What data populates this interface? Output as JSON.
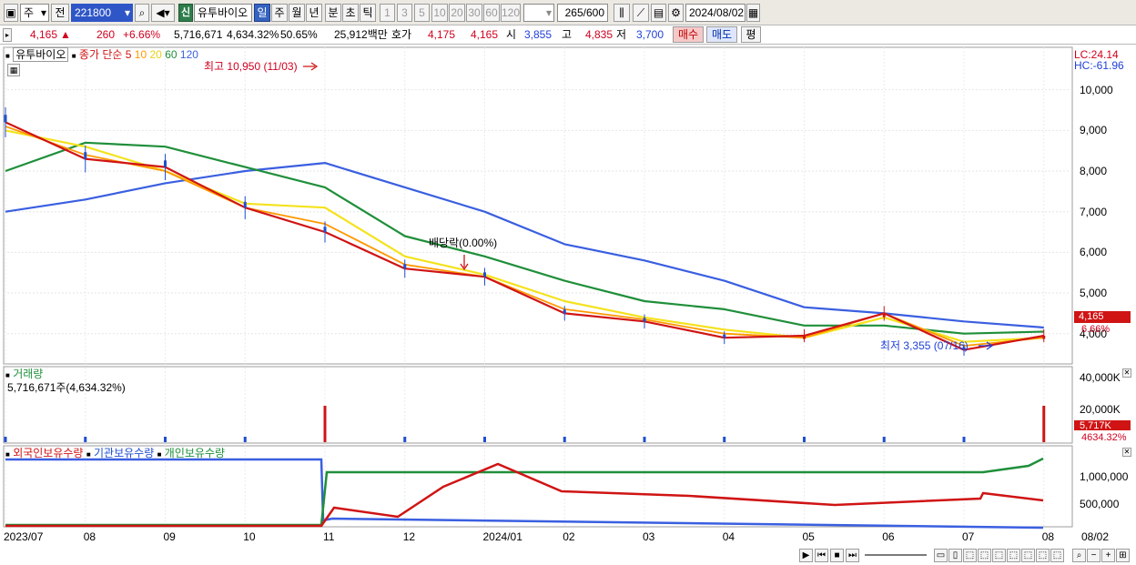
{
  "toolbar": {
    "market": "주",
    "prev_label": "전",
    "code": "221800",
    "stock_name": "유투바이오",
    "new_label": "신",
    "periods": [
      "일",
      "주",
      "월",
      "년",
      "분",
      "초",
      "틱"
    ],
    "selected_period": "일",
    "intervals": [
      "1",
      "3",
      "5",
      "10",
      "20",
      "30",
      "60",
      "120"
    ],
    "count": "265/600",
    "date": "2024/08/02"
  },
  "quote": {
    "price": "4,165",
    "change": "260",
    "change_pct": "+6.66%",
    "volume": "5,716,671",
    "volume_ratio": "4,634.32%",
    "turnover_pct": "50.65%",
    "amount": "25,912백만",
    "hoga_label": "호가",
    "ask": "4,175",
    "bid": "4,165",
    "open_label": "시",
    "open": "3,855",
    "high_label": "고",
    "high": "4,835",
    "low_label": "저",
    "low": "3,700",
    "buy_label": "매수",
    "sell_label": "매도",
    "eval_label": "평"
  },
  "price_panel": {
    "name": "유투바이오",
    "ma_title": "종가 단순",
    "ma_periods": [
      "5",
      "10",
      "20",
      "60",
      "120"
    ],
    "high_annotation": "최고 10,950 (11/03)",
    "low_annotation": "최저 3,355 (07/16)",
    "dividend_annotation": "배당락(0.00%)",
    "lc": "LC:24.14",
    "hc": "HC:-61.96",
    "last_price_tag": "4,165",
    "last_pct_tag": "6.66%",
    "y_labels": [
      "10,000",
      "9,000",
      "8,000",
      "7,000",
      "6,000",
      "5,000",
      "4,000"
    ]
  },
  "volume_panel": {
    "title": "거래량",
    "value_text": "5,716,671주(4,634.32%)",
    "y_labels": [
      "40,000K",
      "20,000K"
    ],
    "last_tag": "5,717K",
    "pct_tag": "4634.32%"
  },
  "holdings_panel": {
    "foreign": "외국인보유수량",
    "institution": "기관보유수량",
    "individual": "개인보유수량",
    "y_labels": [
      "1,000,000",
      "500,000"
    ]
  },
  "x_axis": [
    "2023/07",
    "08",
    "09",
    "10",
    "11",
    "12",
    "2024/01",
    "02",
    "03",
    "04",
    "05",
    "06",
    "07",
    "08",
    "08/02"
  ],
  "colors": {
    "ma5": "#d01414",
    "ma10": "#ff9900",
    "ma20": "#f4e21c",
    "ma60": "#1f8f3a",
    "ma120": "#3a5fe0",
    "up": "#d01414",
    "down": "#1f4fd0"
  },
  "chart_data": {
    "type": "line",
    "title": "유투바이오",
    "x": [
      "2023/07",
      "08",
      "09",
      "10",
      "11",
      "12",
      "2024/01",
      "02",
      "03",
      "04",
      "05",
      "06",
      "07",
      "08"
    ],
    "ylim": [
      3300,
      11000
    ],
    "series": [
      {
        "name": "5",
        "values": [
          9200,
          8300,
          8100,
          7100,
          6500,
          5600,
          5400,
          4500,
          4300,
          3900,
          3950,
          4500,
          3600,
          3950
        ]
      },
      {
        "name": "10",
        "values": [
          9100,
          8400,
          8000,
          7100,
          6700,
          5700,
          5400,
          4600,
          4350,
          4000,
          3900,
          4500,
          3700,
          3900
        ]
      },
      {
        "name": "20",
        "values": [
          9000,
          8600,
          8000,
          7200,
          7100,
          5900,
          5450,
          4800,
          4400,
          4100,
          3900,
          4400,
          3800,
          3900
        ]
      },
      {
        "name": "60",
        "values": [
          8000,
          8700,
          8600,
          8100,
          7600,
          6400,
          5900,
          5300,
          4800,
          4600,
          4200,
          4200,
          4000,
          4050
        ]
      },
      {
        "name": "120",
        "values": [
          7000,
          7300,
          7700,
          8000,
          8200,
          7600,
          7000,
          6200,
          5800,
          5300,
          4650,
          4500,
          4300,
          4150
        ]
      }
    ]
  }
}
